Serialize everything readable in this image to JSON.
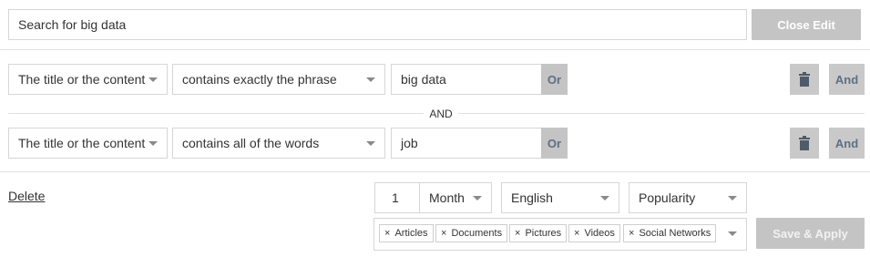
{
  "search": {
    "value": "Search for big data"
  },
  "header": {
    "close_edit_label": "Close Edit"
  },
  "rules": [
    {
      "field": "The title or the content",
      "operator": "contains exactly the phrase",
      "value": "big data",
      "or_label": "Or",
      "and_label": "And"
    },
    {
      "field": "The title or the content",
      "operator": "contains all of the words",
      "value": "job",
      "or_label": "Or",
      "and_label": "And"
    }
  ],
  "connector": "AND",
  "footer": {
    "delete_label": "Delete",
    "period_value": "1",
    "period_unit": "Month",
    "language": "English",
    "sort": "Popularity",
    "tags": [
      "Articles",
      "Documents",
      "Pictures",
      "Videos",
      "Social Networks"
    ],
    "tag_remove_glyph": "×",
    "save_label": "Save & Apply"
  },
  "icons": {
    "trash": "trash-icon",
    "caret": "caret-down-icon"
  },
  "colors": {
    "button_gray": "#c4c4c4",
    "button_text_blue": "#5e6e86",
    "border": "#d6d6d6"
  }
}
